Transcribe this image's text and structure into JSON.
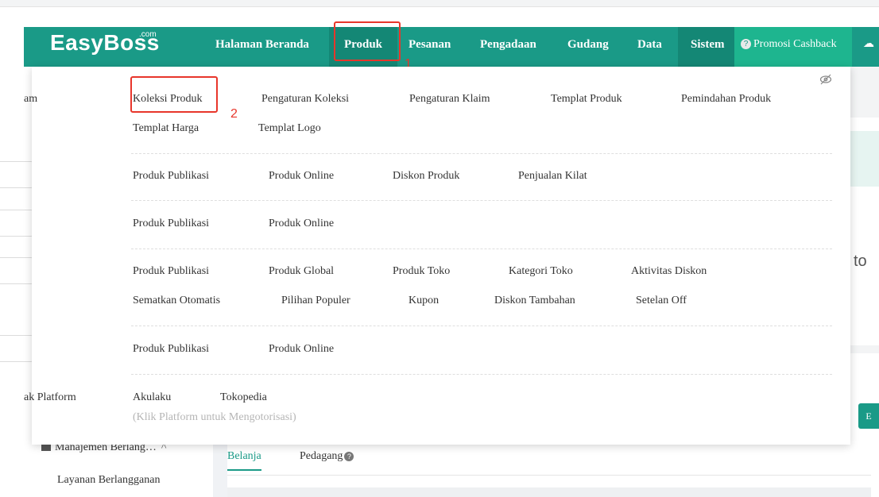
{
  "header": {
    "logo": "EasyBoss",
    "logo_suffix": ".com",
    "nav": [
      {
        "label": "Halaman Beranda"
      },
      {
        "label": "Produk"
      },
      {
        "label": "Pesanan"
      },
      {
        "label": "Pengadaan"
      },
      {
        "label": "Gudang"
      },
      {
        "label": "Data"
      },
      {
        "label": "Sistem"
      }
    ],
    "promo": "Promosi Cashback"
  },
  "annotations": {
    "step1": "1",
    "step2": "2"
  },
  "dropdown": {
    "left_labels": [
      "am",
      "ak Platform"
    ],
    "row1": [
      "Koleksi Produk",
      "Pengaturan Koleksi",
      "Pengaturan Klaim",
      "Templat Produk",
      "Pemindahan Produk"
    ],
    "row1b": [
      "Templat Harga",
      "Templat Logo"
    ],
    "row2": [
      "Produk Publikasi",
      "Produk Online",
      "Diskon Produk",
      "Penjualan Kilat"
    ],
    "row3": [
      "Produk Publikasi",
      "Produk Online"
    ],
    "row4": [
      "Produk Publikasi",
      "Produk Global",
      "Produk Toko",
      "Kategori Toko",
      "Aktivitas Diskon"
    ],
    "row4b": [
      "Sematkan Otomatis",
      "Pilihan Populer",
      "Kupon",
      "Diskon Tambahan",
      "Setelan Off"
    ],
    "row5": [
      "Produk Publikasi",
      "Produk Online"
    ],
    "row6": [
      "Akulaku",
      "Tokopedia"
    ],
    "hint": "(Klik Platform untuk Mengotorisasi)"
  },
  "background": {
    "sidebar_group": "Manajemen Berlang…",
    "sidebar_item": "Layanan Berlangganan",
    "tabs": [
      "Belanja",
      "Pedagang"
    ],
    "right_cut_text": "to",
    "right_btn": "E"
  },
  "colors": {
    "brand": "#1a9a87",
    "annotation": "#e8362b"
  }
}
